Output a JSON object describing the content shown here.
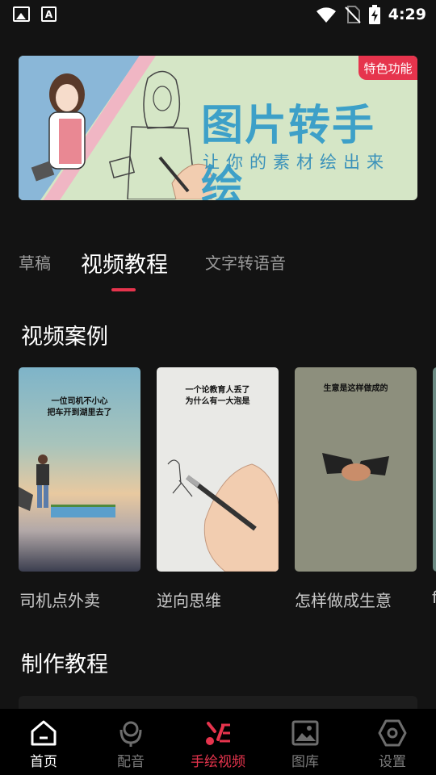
{
  "status_bar": {
    "time": "4:29",
    "icons": [
      "image-notification-icon",
      "text-notification-icon",
      "wifi-icon",
      "no-sim-icon",
      "battery-charging-icon"
    ]
  },
  "banner": {
    "badge": "特色功能",
    "title": "图片转手绘",
    "subtitle": "让你的素材绘出来"
  },
  "tabs": [
    {
      "label": "草稿",
      "active": false
    },
    {
      "label": "视频教程",
      "active": true
    },
    {
      "label": "文字转语音",
      "active": false
    }
  ],
  "sections": {
    "cases_title": "视频案例",
    "tutorial_title": "制作教程"
  },
  "cases": [
    {
      "caption": "司机点外卖",
      "overlay_text": "一位司机不小心\n把车开到湖里去了"
    },
    {
      "caption": "逆向思维",
      "overlay_text": "一个论教育人丢了\n为什么有一大泡是"
    },
    {
      "caption": "怎样做成生意",
      "overlay_text": "生意是这样做成的"
    },
    {
      "caption": "f"
    }
  ],
  "bottom_nav": [
    {
      "label": "首页",
      "icon": "home-icon"
    },
    {
      "label": "配音",
      "icon": "microphone-icon"
    },
    {
      "label": "手绘视频",
      "icon": "hand-drawn-video-icon",
      "active": true
    },
    {
      "label": "图库",
      "icon": "gallery-icon"
    },
    {
      "label": "设置",
      "icon": "settings-icon"
    }
  ],
  "colors": {
    "accent": "#e6344d",
    "background": "#131313",
    "banner_green": "#d5e6c6",
    "banner_text_blue": "#3da0c8"
  }
}
